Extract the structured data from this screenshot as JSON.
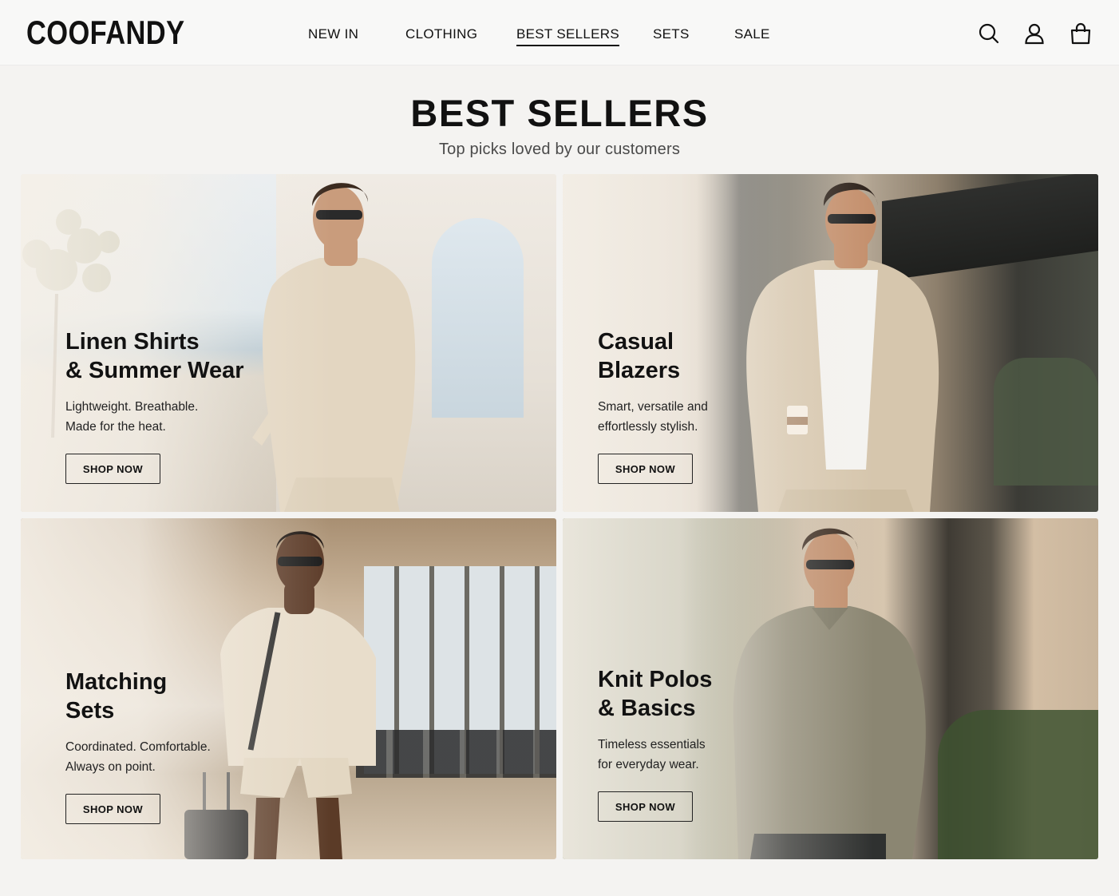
{
  "brand": {
    "logo": "COOFANDY"
  },
  "nav": {
    "items": [
      {
        "label": "NEW IN",
        "active": false
      },
      {
        "label": "CLOTHING",
        "active": false
      },
      {
        "label": "BEST SELLERS",
        "active": true
      },
      {
        "label": "SETS",
        "active": false
      },
      {
        "label": "SALE",
        "active": false
      }
    ]
  },
  "header_icons": [
    "search-icon",
    "account-icon",
    "shopping-bag-icon"
  ],
  "section": {
    "title": "BEST SELLERS",
    "subtitle": "Top picks loved by our customers"
  },
  "cards": [
    {
      "title": "Linen Shirts\n& Summer Wear",
      "description": "Lightweight. Breathable.\nMade for the heat.",
      "button": "SHOP NOW",
      "scene": "seaside terrace, man in beige linen shirt"
    },
    {
      "title": "Casual\nBlazers",
      "description": "Smart, versatile and\neffortlessly stylish.",
      "button": "SHOP NOW",
      "scene": "city street, man in beige blazer with coffee cup"
    },
    {
      "title": "Matching\nSets",
      "description": "Coordinated. Comfortable.\nAlways on point.",
      "button": "SHOP NOW",
      "scene": "airport lounge, man in matching shirt and shorts set"
    },
    {
      "title": "Knit Polos\n& Basics",
      "description": "Timeless essentials\nfor everyday wear.",
      "button": "SHOP NOW",
      "scene": "urban sidewalk, man in knit polo"
    }
  ],
  "colors": {
    "page_bg": "#f4f3f1",
    "text": "#111111",
    "card_fade": "#f5f0e8"
  }
}
